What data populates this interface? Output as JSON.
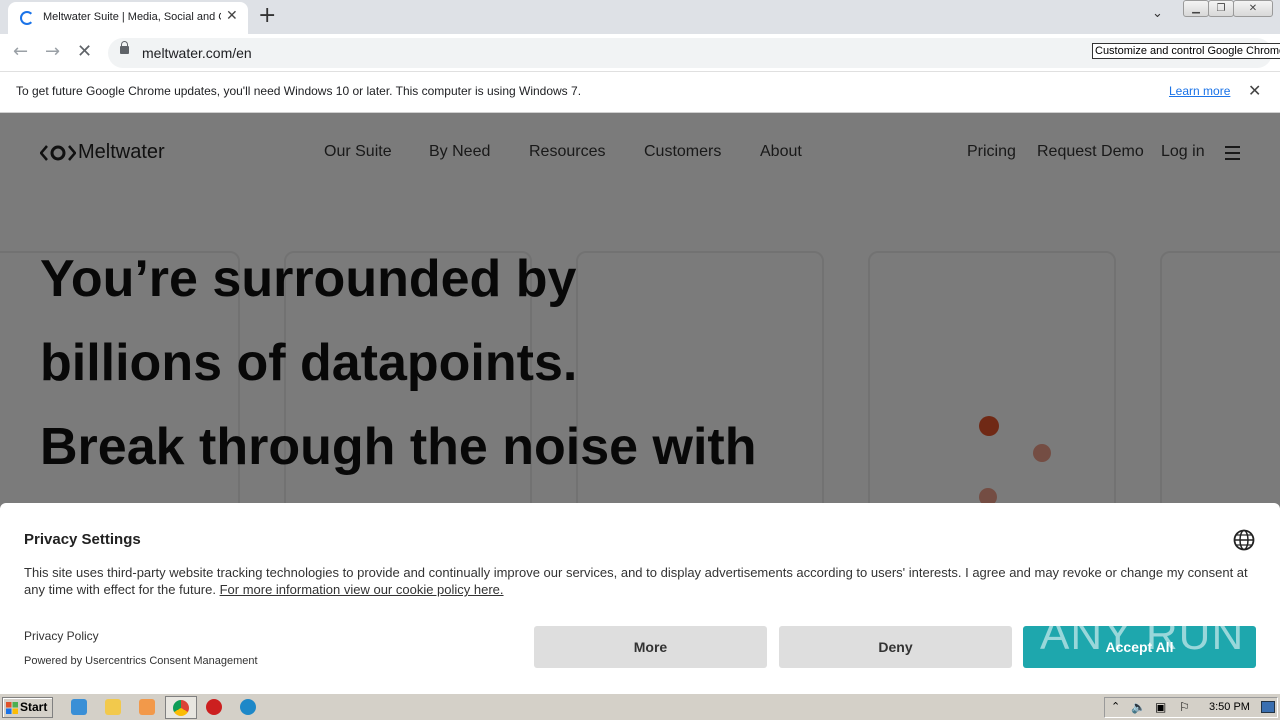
{
  "browser": {
    "tab_title": "Meltwater Suite | Media, Social and Consumer Intelligence",
    "url": "meltwater.com/en",
    "tooltip": "Customize and control Google Chrome",
    "infobar_message": "To get future Google Chrome updates, you'll need Windows 10 or later. This computer is using Windows 7.",
    "infobar_link": "Learn more"
  },
  "site": {
    "logo_text": "Meltwater",
    "nav": [
      "Our Suite",
      "By Need",
      "Resources",
      "Customers",
      "About"
    ],
    "right_nav": [
      "Pricing",
      "Request Demo",
      "Log in"
    ],
    "hero_lines": [
      "You’re surrounded by",
      "billions of datapoints.",
      "Break through the noise with"
    ]
  },
  "privacy": {
    "title": "Privacy Settings",
    "body": "This site uses third-party website tracking technologies to provide and continually improve our services, and to display advertisements according to users' interests. I agree and may revoke or change my consent at any time with effect for the future. ",
    "body_link": "For more information view our cookie policy here.",
    "privacy_policy": "Privacy Policy",
    "powered_by": "Powered by Usercentrics Consent Management",
    "buttons": {
      "more": "More",
      "deny": "Deny",
      "accept": "Accept All"
    },
    "accept_color": "#1ea7ad"
  },
  "watermark": "ANY RUN",
  "taskbar": {
    "start_label": "Start",
    "clock": "3:50 PM",
    "icons": [
      "ie-icon",
      "explorer-folder-icon",
      "media-player-icon",
      "chrome-icon",
      "opera-icon",
      "edge-icon"
    ]
  },
  "colors": {
    "brand_dot": "#e0522a",
    "teal": "#1ea7ad"
  }
}
